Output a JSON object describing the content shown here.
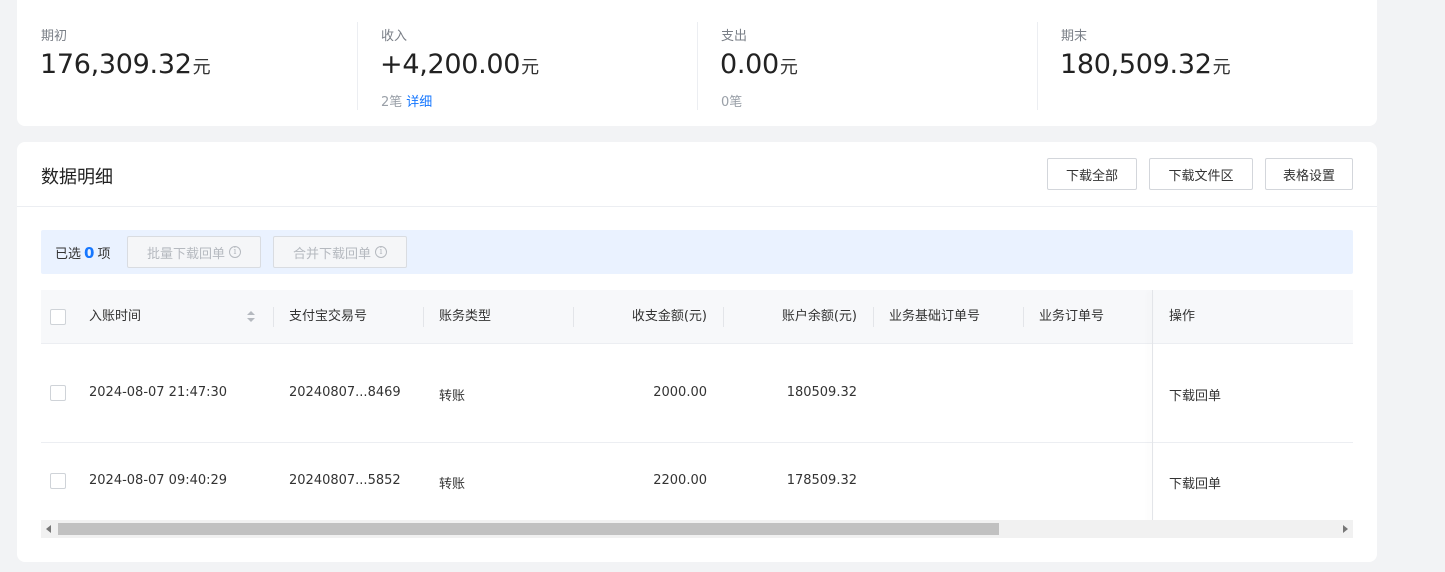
{
  "summary": [
    {
      "label": "期初",
      "value": "176,309.32",
      "unit": "元",
      "sub_count": "",
      "sub_link": ""
    },
    {
      "label": "收入",
      "value": "+4,200.00",
      "unit": "元",
      "sub_count": "2笔",
      "sub_link": "详细"
    },
    {
      "label": "支出",
      "value": "0.00",
      "unit": "元",
      "sub_count": "0笔",
      "sub_link": ""
    },
    {
      "label": "期末",
      "value": "180,509.32",
      "unit": "元",
      "sub_count": "",
      "sub_link": ""
    }
  ],
  "detail": {
    "title": "数据明细",
    "buttons": {
      "download_all": "下载全部",
      "download_files": "下载文件区",
      "table_settings": "表格设置"
    }
  },
  "selection": {
    "prefix": "已选",
    "count": "0",
    "suffix": "项",
    "batch_download": "批量下载回单",
    "merge_download": "合并下载回单"
  },
  "table": {
    "columns": {
      "time": "入账时间",
      "trade_no": "支付宝交易号",
      "type": "账务类型",
      "amount": "收支金额(元)",
      "balance": "账户余额(元)",
      "base_order": "业务基础订单号",
      "order": "业务订单号",
      "action": "操作"
    },
    "rows": [
      {
        "time": "2024-08-07 21:47:30",
        "trade_no": "20240807...8469",
        "type": "转账",
        "amount": "2000.00",
        "balance": "180509.32",
        "action": "下载回单"
      },
      {
        "time": "2024-08-07 09:40:29",
        "trade_no": "20240807...5852",
        "type": "转账",
        "amount": "2200.00",
        "balance": "178509.32",
        "action": "下载回单"
      }
    ]
  }
}
